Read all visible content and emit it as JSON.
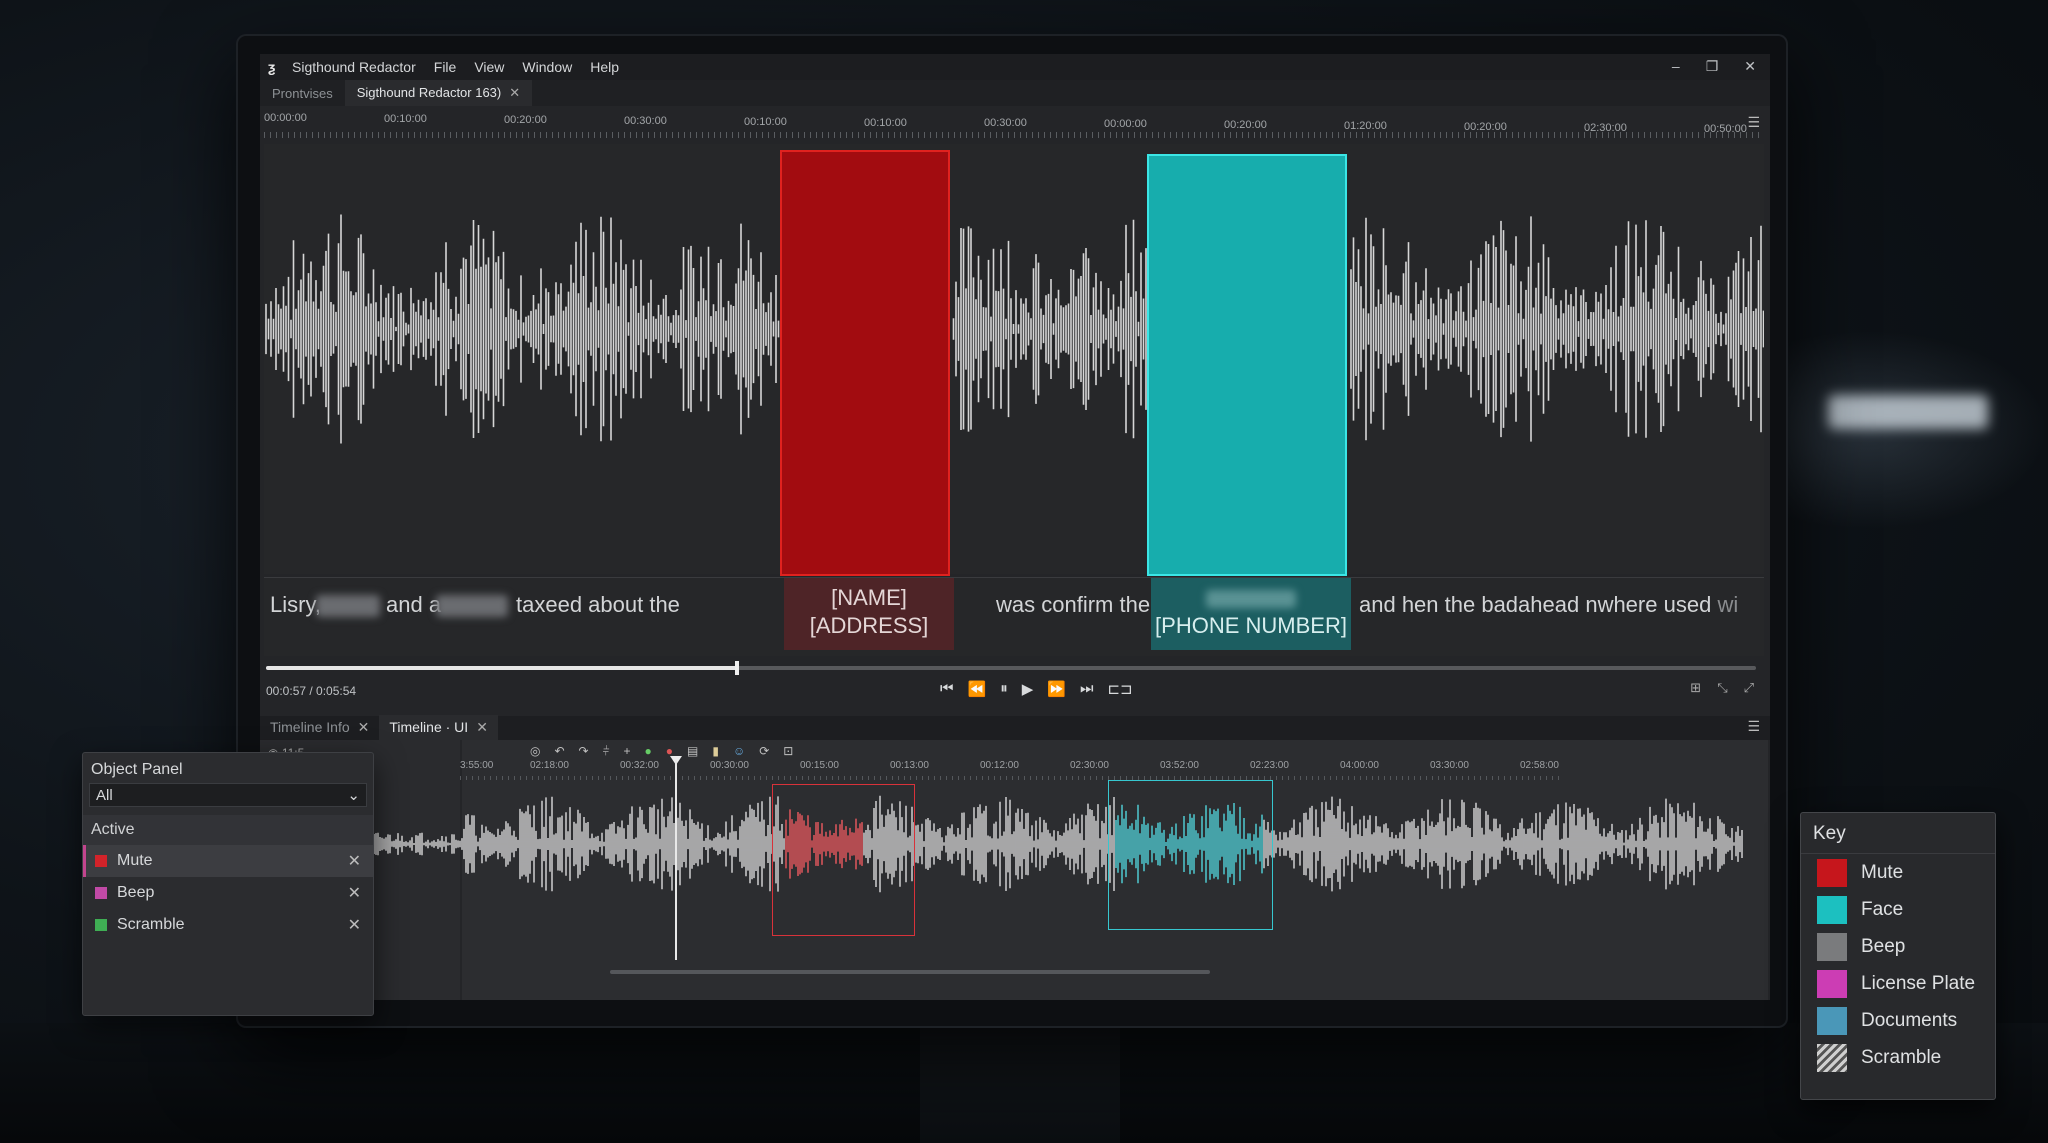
{
  "app": {
    "title": "Sigthound Redactor",
    "menu": [
      "File",
      "View",
      "Window",
      "Help"
    ],
    "window_controls": [
      "–",
      "❐",
      "✕"
    ]
  },
  "tabs": [
    {
      "label": "Prontvises"
    },
    {
      "label": "Sigthound Redactor 163)",
      "active": true
    }
  ],
  "ruler_ticks": [
    "00:00:00",
    "00:10:00",
    "00:20:00",
    "00:30:00",
    "00:10:00",
    "00:10:00",
    "00:30:00",
    "00:00:00",
    "00:20:00",
    "01:20:00",
    "00:20:00",
    "02:30:00",
    "00:50:00"
  ],
  "transcript": {
    "part1": "Lisry,",
    "part2": "and a",
    "part3": "taxeed about the",
    "red_label_1": "[NAME]",
    "red_label_2": "[ADDRESS]",
    "part4": "was confirm the",
    "teal_label": "[PHONE NUMBER]",
    "part5": "and hen the badahead nwhere used",
    "part5_fade": "wi"
  },
  "playback": {
    "time": "00:0:57 / 0:05:54",
    "progress": 0.316
  },
  "lower_tabs": [
    {
      "label": "Timeline Info"
    },
    {
      "label": "Timeline · UI",
      "active": true
    }
  ],
  "timeline": {
    "zoom_label": "11:5",
    "start_label": "3:55:00",
    "ticks": [
      "02:18:00",
      "00:32:00",
      "00:30:00",
      "00:15:00",
      "00:13:00",
      "00:12:00",
      "02:30:00",
      "03:52:00",
      "02:23:00",
      "04:00:00",
      "03:30:00",
      "02:58:00"
    ]
  },
  "object_panel": {
    "title": "Object Panel",
    "filter": "All",
    "section": "Active",
    "items": [
      {
        "label": "Mute",
        "color": "#d2232a",
        "selected": true
      },
      {
        "label": "Beep",
        "color": "#c14aa6"
      },
      {
        "label": "Scramble",
        "color": "#3fae54"
      }
    ]
  },
  "key": {
    "title": "Key",
    "items": [
      {
        "label": "Mute",
        "color": "#c6161c"
      },
      {
        "label": "Face",
        "color": "#1cc0c0"
      },
      {
        "label": "Beep",
        "color": "#7a7b7d"
      },
      {
        "label": "License Plate",
        "color": "#cc3db4"
      },
      {
        "label": "Documents",
        "color": "#4a97b8"
      },
      {
        "label": "Scramble",
        "color": "hatch"
      }
    ]
  },
  "colors": {
    "mute": "#a20c10",
    "face": "#17adad"
  }
}
